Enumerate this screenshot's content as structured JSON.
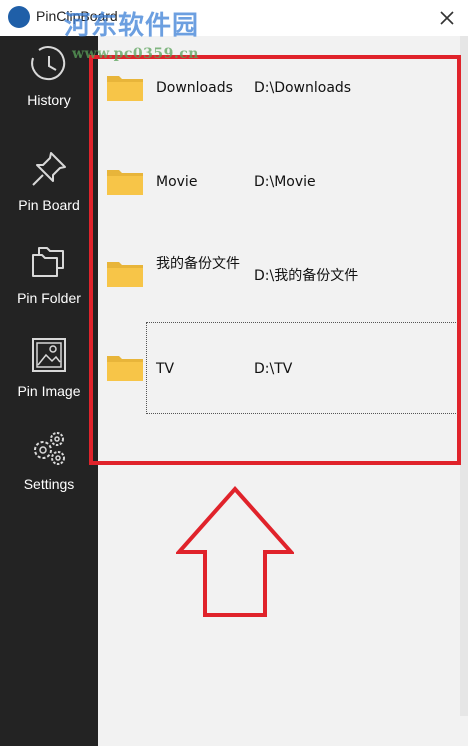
{
  "app": {
    "title": "PinClipBoard",
    "watermark_text": "河东软件园",
    "watermark_url": "www.pc0359.cn"
  },
  "sidebar": {
    "items": [
      {
        "label": "History",
        "icon": "clock-icon"
      },
      {
        "label": "Pin Board",
        "icon": "pin-icon"
      },
      {
        "label": "Pin Folder",
        "icon": "folders-icon"
      },
      {
        "label": "Pin Image",
        "icon": "image-icon"
      },
      {
        "label": "Settings",
        "icon": "gears-icon"
      }
    ]
  },
  "folders": [
    {
      "name": "Downloads",
      "path": "D:\\Downloads"
    },
    {
      "name": "Movie",
      "path": "D:\\Movie"
    },
    {
      "name": "我的备份文件",
      "path": "D:\\我的备份文件"
    },
    {
      "name": "TV",
      "path": "D:\\TV"
    }
  ],
  "colors": {
    "sidebar_bg": "#232323",
    "content_bg": "#f2f2f2",
    "folder_yellow": "#f7c548",
    "annotation_red": "#e0232b"
  }
}
